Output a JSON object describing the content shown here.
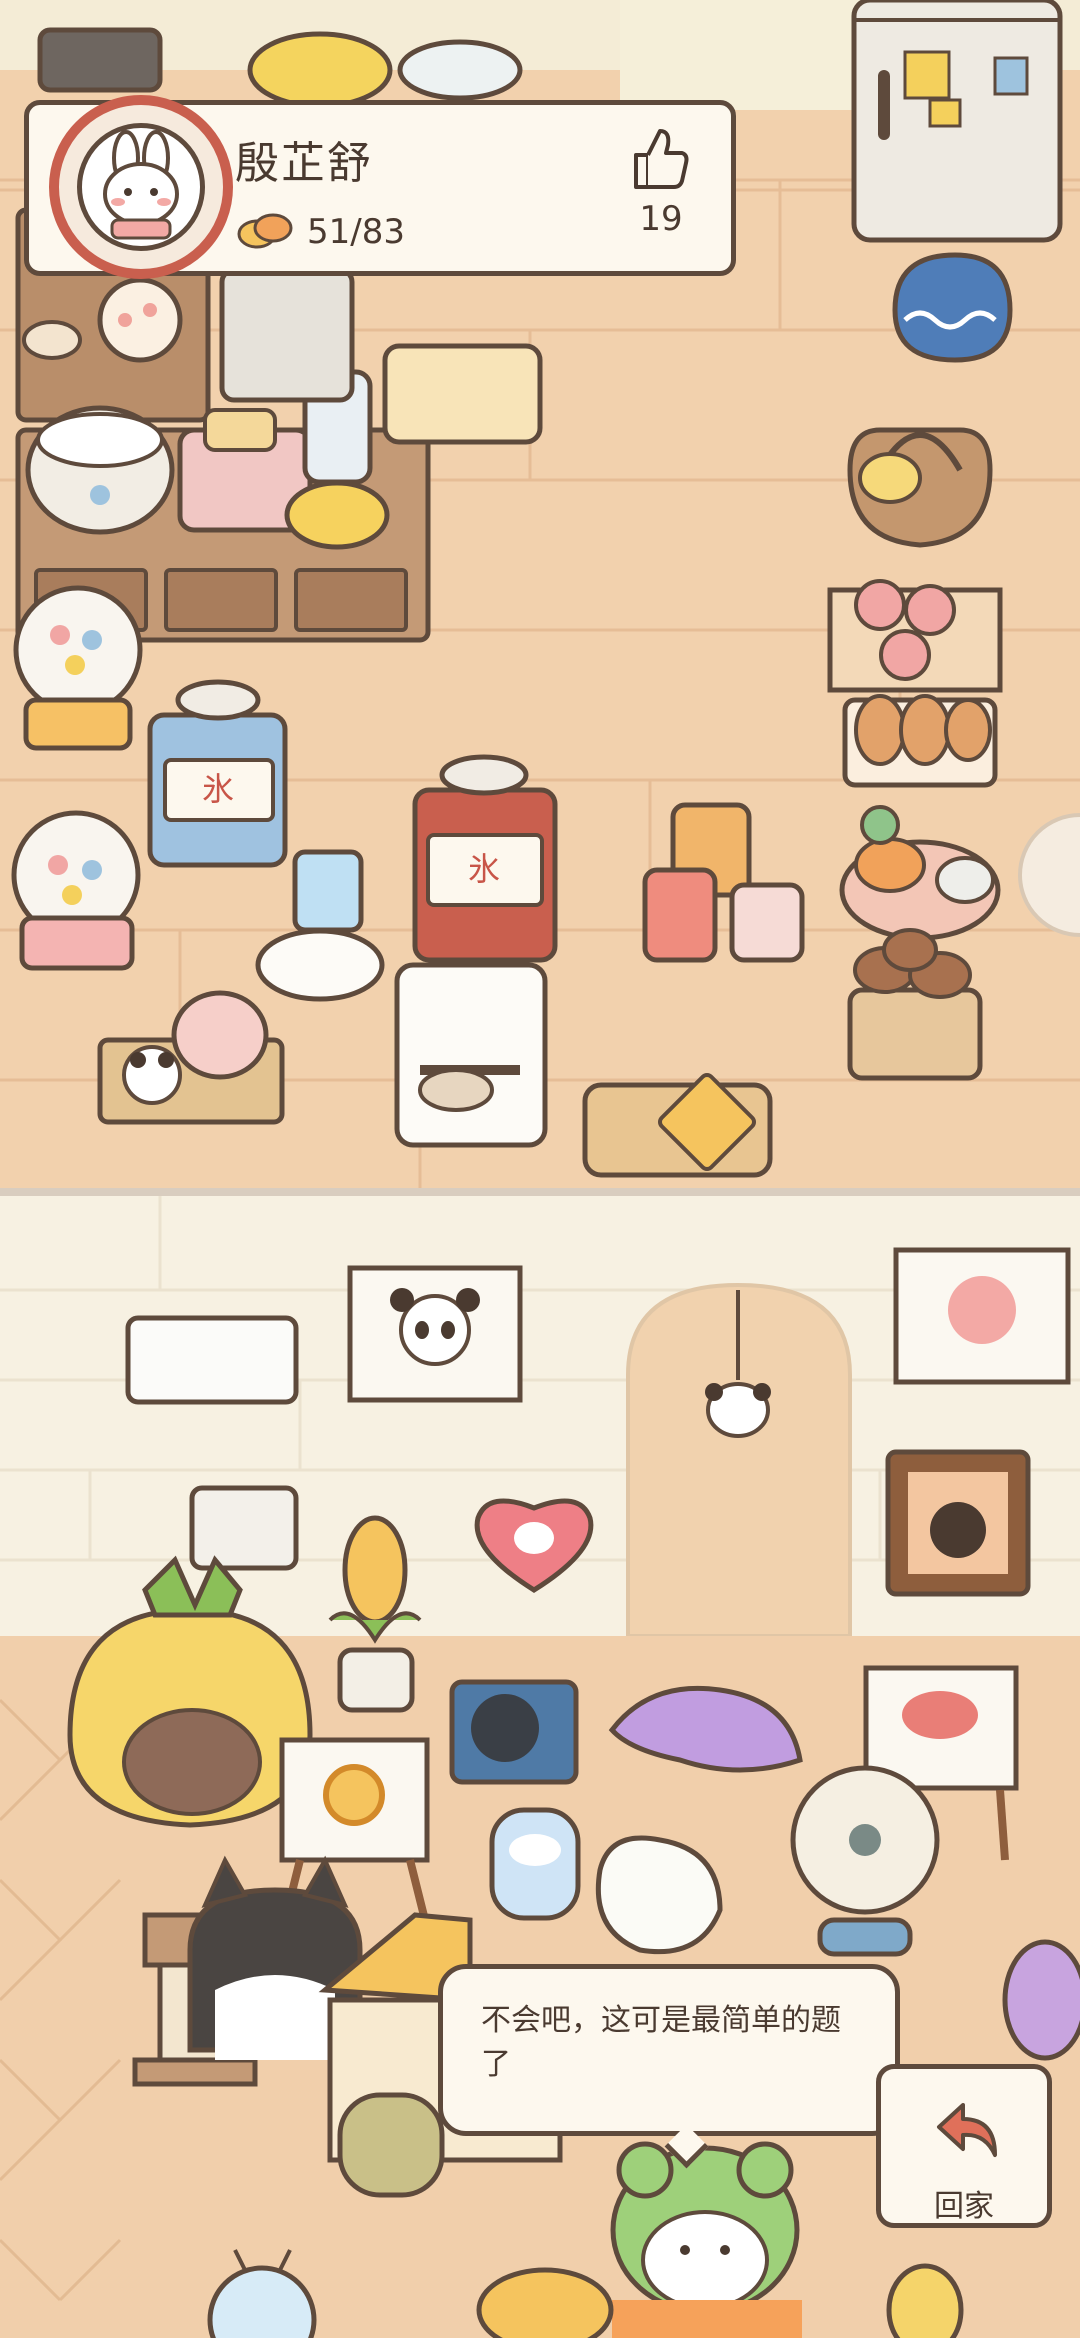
{
  "player": {
    "name": "殷芷舒",
    "progress": "51/83",
    "likes": "19"
  },
  "speech": {
    "text": "不会吧，这可是最简单的题了"
  },
  "home_button": {
    "label": "回家"
  },
  "icons": {
    "like": "thumbs-up-icon",
    "collection": "bread-icon",
    "back": "return-arrow-icon"
  },
  "colors": {
    "panel_bg": "#fdf8ee",
    "outline": "#5e4a3c",
    "avatar_ring": "#c95f4e",
    "floor": "#f0cda8",
    "wall": "#f7f1e2",
    "back_arrow": "#e0705a"
  }
}
